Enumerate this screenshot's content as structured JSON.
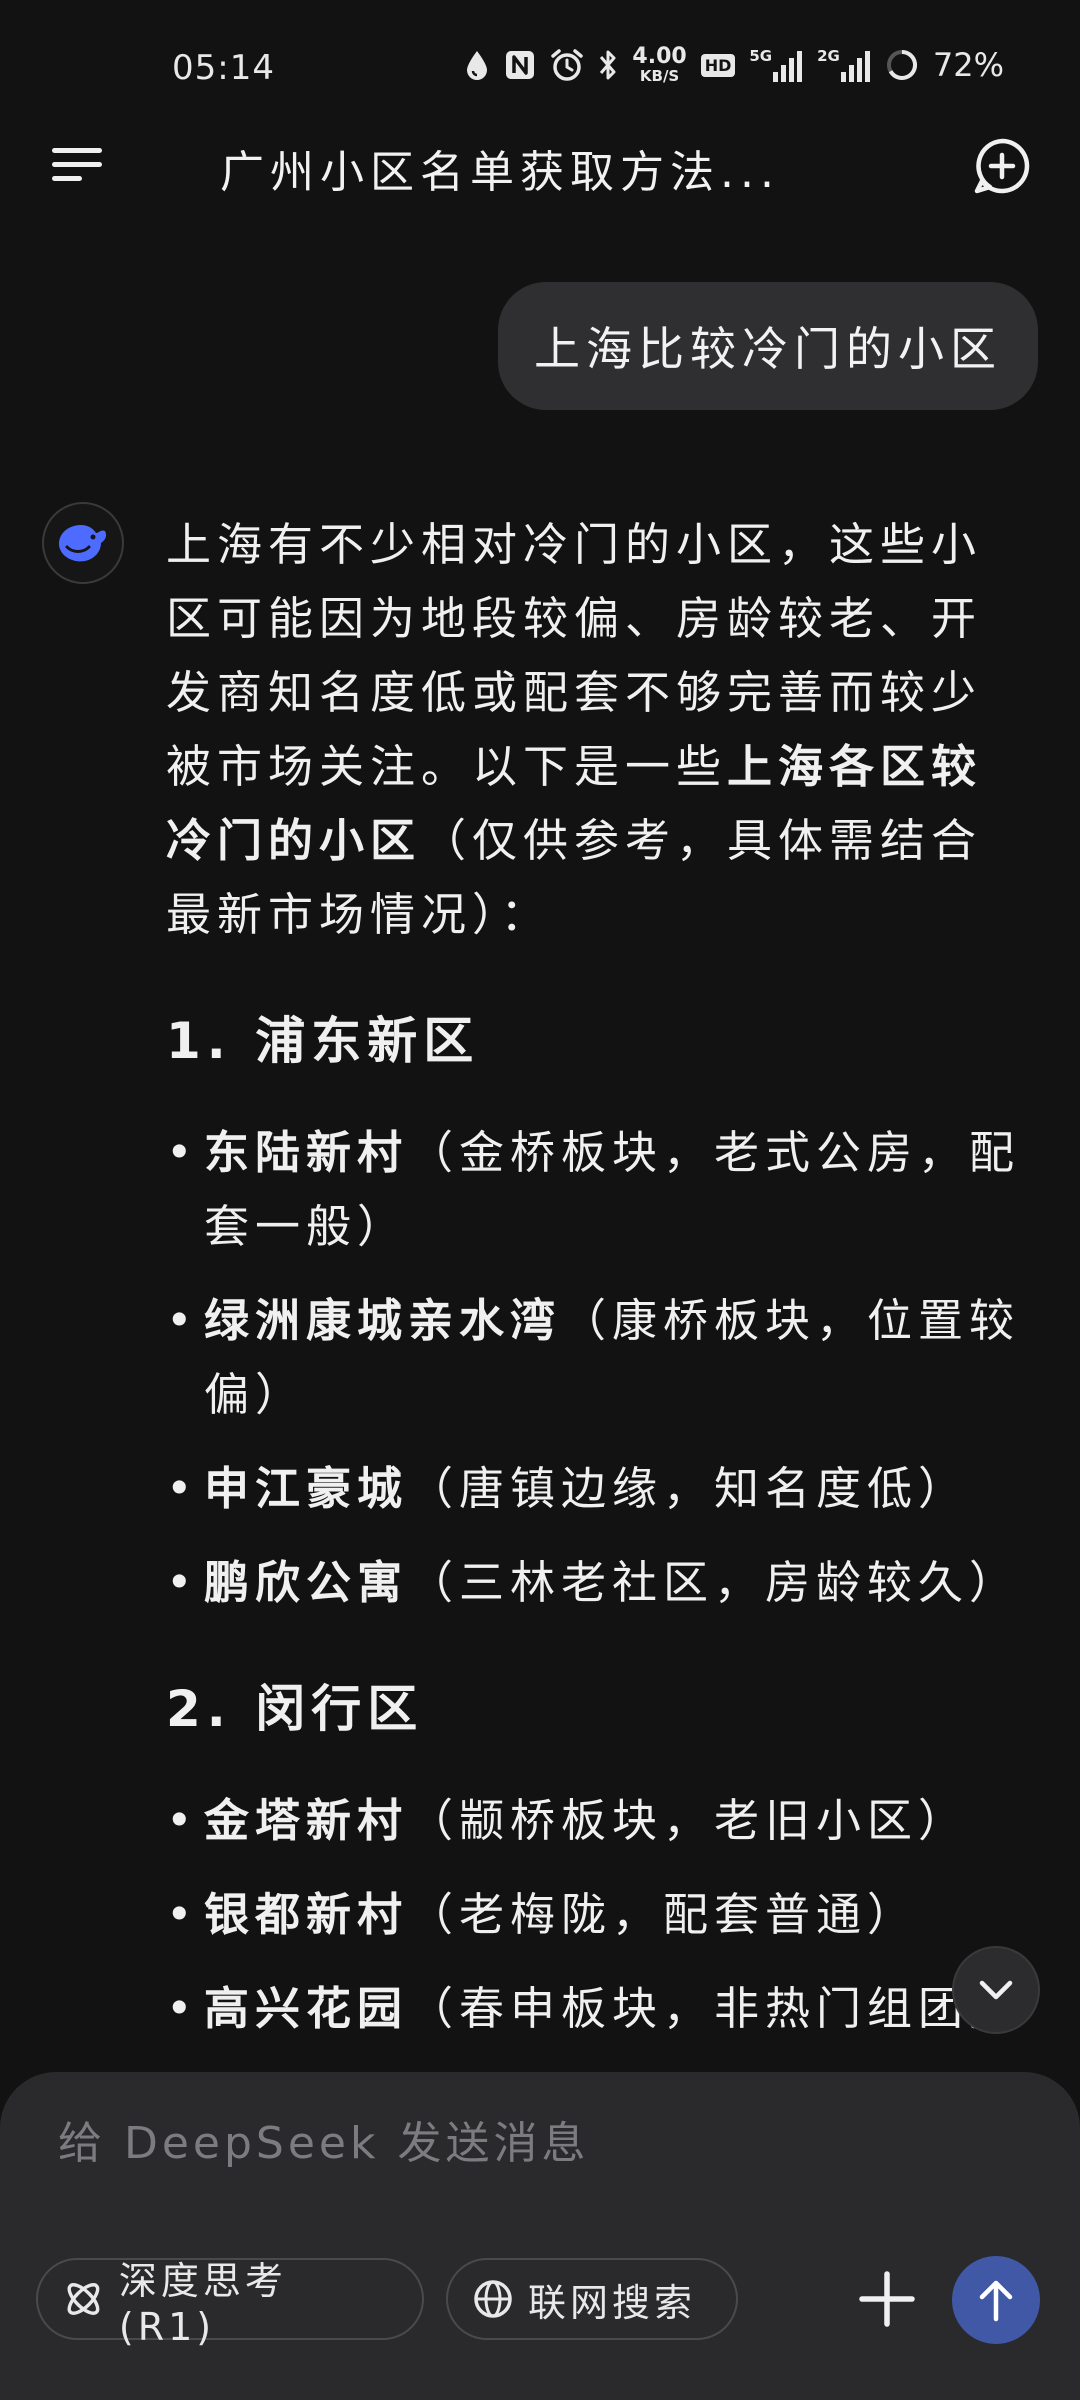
{
  "status_bar": {
    "time": "05:14",
    "net_speed_value": "4.00",
    "net_speed_unit": "KB/S",
    "hd_badge": "HD",
    "signal1_label": "5G",
    "signal2_label": "2G",
    "battery": "72%"
  },
  "header": {
    "title": "广州小区名单获取方法..."
  },
  "chat": {
    "user_message": "上海比较冷门的小区",
    "ai_intro_1": "上海有不少相对冷门的小区，这些小区可能因为地段较偏、房龄较老、开发商知名度低或配套不够完善而较少被市场关注。以下是一些",
    "ai_intro_bold": "上海各区较冷门的小区",
    "ai_intro_2": "（仅供参考，具体需结合最新市场情况）：",
    "sections": [
      {
        "heading": "1. 浦东新区",
        "items": [
          {
            "name": "东陆新村",
            "desc": "（金桥板块，老式公房，配套一般）"
          },
          {
            "name": "绿洲康城亲水湾",
            "desc": "（康桥板块，位置较偏）"
          },
          {
            "name": "申江豪城",
            "desc": "（唐镇边缘，知名度低）"
          },
          {
            "name": "鹏欣公寓",
            "desc": "（三林老社区，房龄较久）"
          }
        ]
      },
      {
        "heading": "2. 闵行区",
        "items": [
          {
            "name": "金塔新村",
            "desc": "（颛桥板块，老旧小区）"
          },
          {
            "name": "银都新村",
            "desc": "（老梅陇，配套普通）"
          },
          {
            "name": "高兴花园",
            "desc": "（春申板块，非热门组团）"
          }
        ]
      }
    ]
  },
  "composer": {
    "placeholder": "给 DeepSeek 发送消息",
    "deep_think_label": "深度思考 (R1)",
    "web_search_label": "联网搜索"
  },
  "colors": {
    "background": "#121212",
    "bubble": "#2f2f31",
    "panel": "#2a2a2c",
    "accent": "#4d6bfe",
    "send_button": "#4058a6"
  }
}
